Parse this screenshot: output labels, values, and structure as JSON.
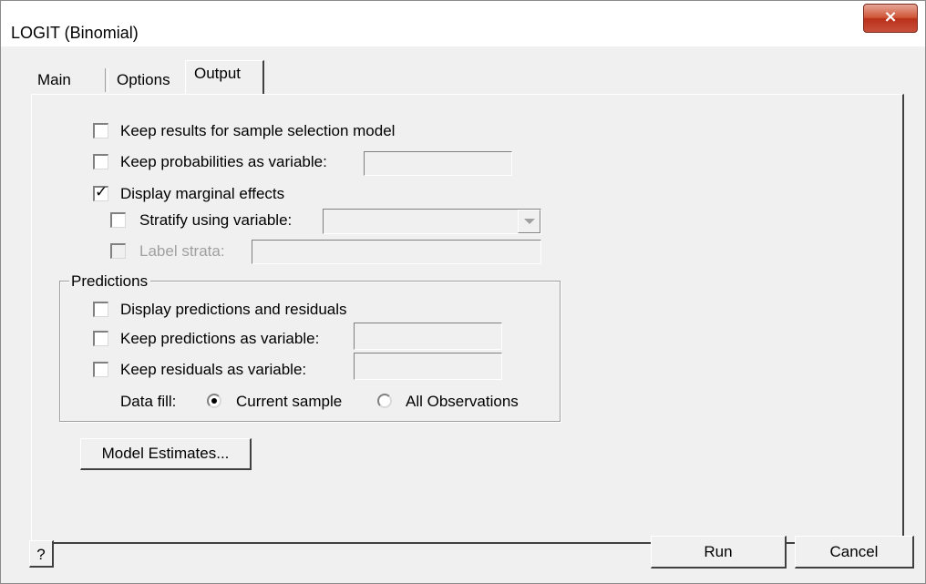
{
  "window": {
    "title": "LOGIT (Binomial)",
    "close_icon": "close-icon",
    "close_glyph": "×"
  },
  "tabs": [
    {
      "label": "Main",
      "active": false
    },
    {
      "label": "Options",
      "active": false
    },
    {
      "label": "Output",
      "active": true
    }
  ],
  "output": {
    "keep_results": {
      "label": "Keep results for sample selection model",
      "checked": false
    },
    "keep_probabilities": {
      "label": "Keep probabilities as variable:",
      "checked": false,
      "value": ""
    },
    "display_marginal": {
      "label": "Display marginal effects",
      "checked": true,
      "check_glyph": "✓"
    },
    "stratify": {
      "label": "Stratify using variable:",
      "checked": false,
      "value": ""
    },
    "label_strata": {
      "label": "Label strata:",
      "checked": false,
      "enabled": false,
      "value": ""
    }
  },
  "predictions": {
    "title": "Predictions",
    "display_predictions": {
      "label": "Display predictions and residuals",
      "checked": false
    },
    "keep_predictions": {
      "label": "Keep predictions as variable:",
      "checked": false,
      "value": ""
    },
    "keep_residuals": {
      "label": "Keep residuals as variable:",
      "checked": false,
      "value": ""
    },
    "data_fill": {
      "label": "Data fill:",
      "options": [
        {
          "label": "Current sample",
          "selected": true
        },
        {
          "label": "All Observations",
          "selected": false
        }
      ]
    }
  },
  "buttons": {
    "model_estimates": "Model Estimates...",
    "help": "?",
    "run": "Run",
    "cancel": "Cancel"
  },
  "colors": {
    "dialog_bg": "#f0f0f0",
    "close_button": "#c9432b",
    "disabled_text": "#a0a0a0"
  }
}
